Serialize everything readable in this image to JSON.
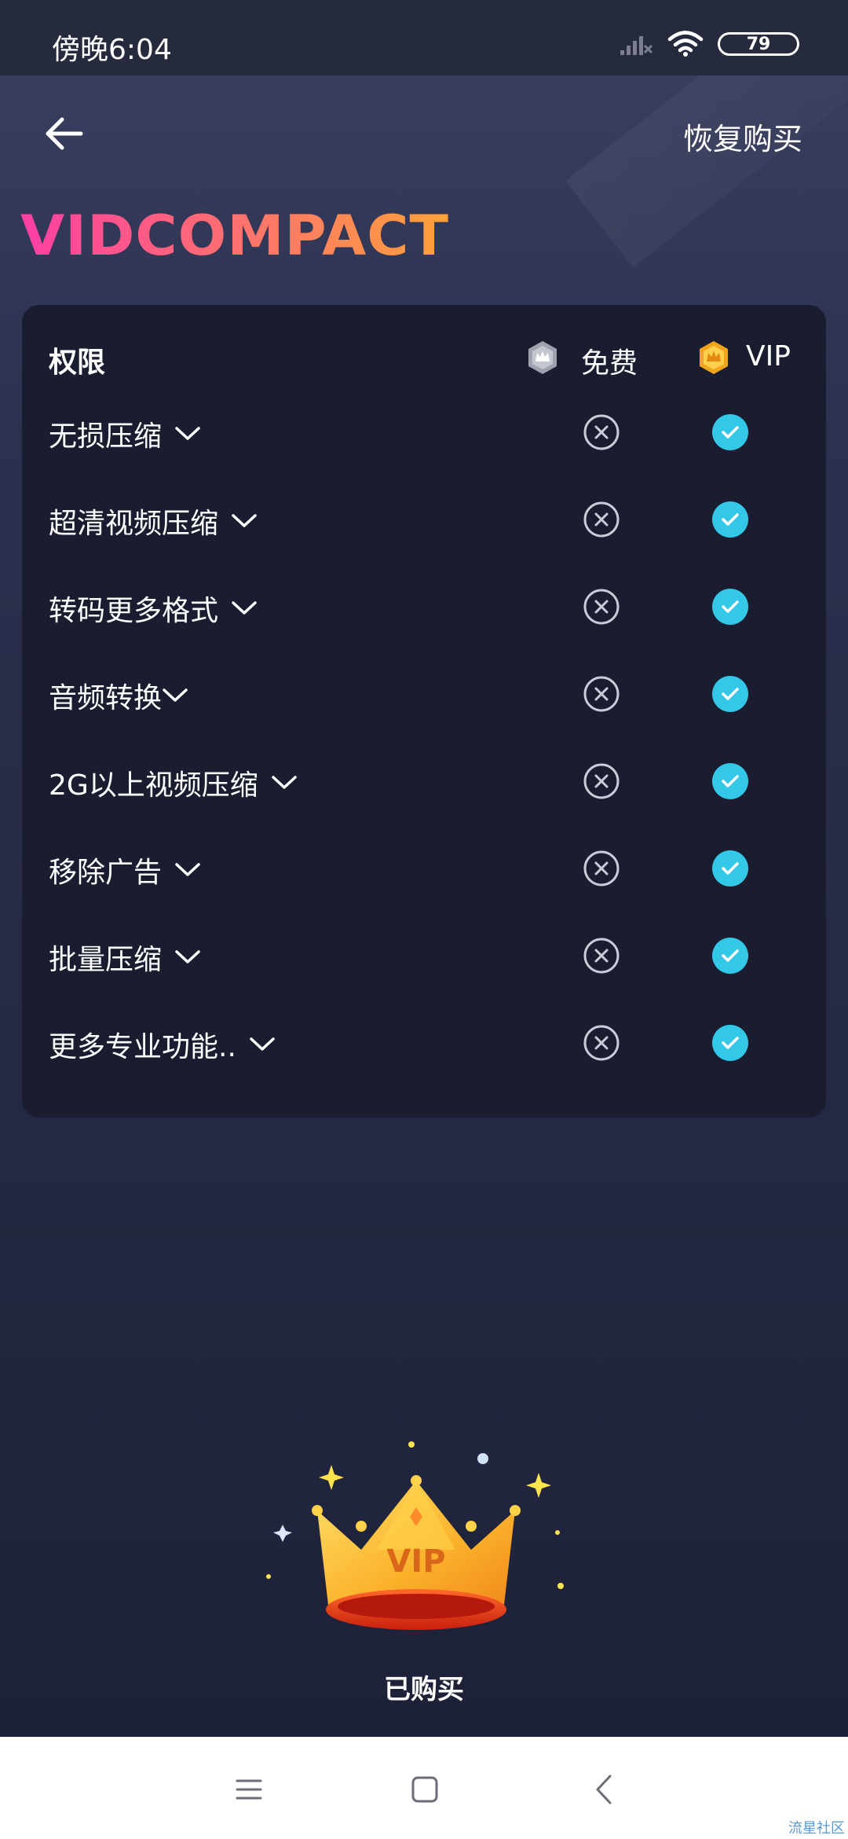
{
  "status_bar": {
    "time": "傍晚6:04",
    "battery": "79"
  },
  "header": {
    "restore_label": "恢复购买",
    "logo_text": "VIDCOMPACT"
  },
  "table": {
    "header_label": "权限",
    "free_label": "免费",
    "vip_label": "VIP",
    "rows": [
      {
        "label": "无损压缩"
      },
      {
        "label": "超清视频压缩"
      },
      {
        "label": "转码更多格式"
      },
      {
        "label": "音频转换"
      },
      {
        "label": "2G以上视频压缩"
      },
      {
        "label": "移除广告"
      },
      {
        "label": "批量压缩"
      },
      {
        "label": "更多专业功能.."
      }
    ]
  },
  "crown": {
    "badge_text": "VIP"
  },
  "status_text": "已购买",
  "watermark": "流星社区",
  "colors": {
    "check": "#33c8e8",
    "cross": "#c9cbd6",
    "logo_start": "#ff3fa4",
    "logo_end": "#ff9a3c",
    "vip_gold": "#f6b623"
  }
}
